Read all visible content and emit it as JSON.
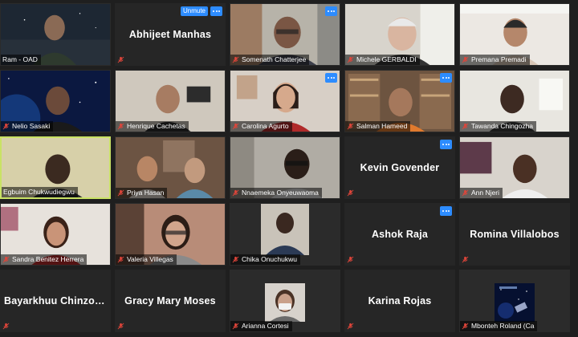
{
  "controls": {
    "unmute_label": "Unmute"
  },
  "tiles": [
    {
      "name": "Ram - OAD"
    },
    {
      "name": "Abhijeet Manhas"
    },
    {
      "name": "Somenath Chatterjee"
    },
    {
      "name": "Michele GERBALDI"
    },
    {
      "name": "Premana Premadi"
    },
    {
      "name": "Nelio Sasaki"
    },
    {
      "name": "Henrique Cachetas"
    },
    {
      "name": "Carolina Agurto"
    },
    {
      "name": "Salman Hameed"
    },
    {
      "name": "Tawanda Chingozha"
    },
    {
      "name": "Egbuim Chukwudiegwu"
    },
    {
      "name": "Priya Hasan"
    },
    {
      "name": "Nnaemeka Onyeuwaoma"
    },
    {
      "name": "Kevin Govender"
    },
    {
      "name": "Ann Njeri"
    },
    {
      "name": "Sandra Benitez Herrera"
    },
    {
      "name": "Valeria Villegas"
    },
    {
      "name": "Chika Onuchukwu"
    },
    {
      "name": "Ashok Raja"
    },
    {
      "name": "Romina Villalobos"
    },
    {
      "name": "Bayarkhuu Chinzorig"
    },
    {
      "name": "Gracy Mary Moses"
    },
    {
      "name": "Arianna Cortesi"
    },
    {
      "name": "Karina Rojas"
    },
    {
      "name": "Mbonteh Roland (Ca"
    }
  ],
  "colors": {
    "accent": "#2d8cff",
    "speaking_border": "#c9e265",
    "muted_icon": "#e0453a"
  }
}
